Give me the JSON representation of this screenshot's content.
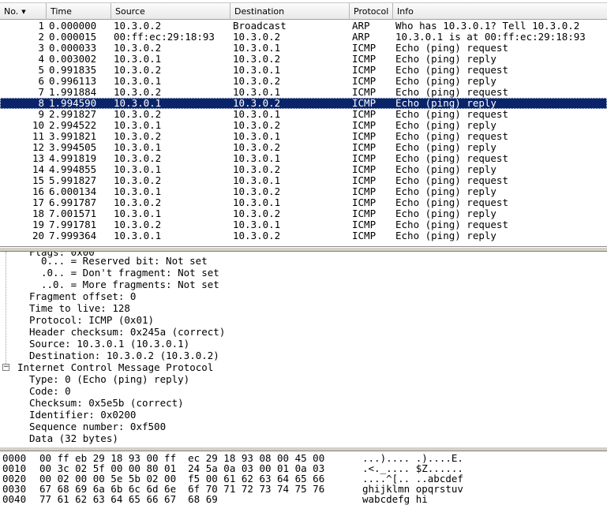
{
  "columns": {
    "no": "No.",
    "time": "Time",
    "source": "Source",
    "destination": "Destination",
    "protocol": "Protocol",
    "info": "Info"
  },
  "packets": [
    {
      "no": "1",
      "time": "0.000000",
      "source": "10.3.0.2",
      "destination": "Broadcast",
      "protocol": "ARP",
      "info": "Who has 10.3.0.1?  Tell 10.3.0.2"
    },
    {
      "no": "2",
      "time": "0.000015",
      "source": "00:ff:ec:29:18:93",
      "destination": "10.3.0.2",
      "protocol": "ARP",
      "info": "10.3.0.1 is at 00:ff:ec:29:18:93"
    },
    {
      "no": "3",
      "time": "0.000033",
      "source": "10.3.0.2",
      "destination": "10.3.0.1",
      "protocol": "ICMP",
      "info": "Echo (ping) request"
    },
    {
      "no": "4",
      "time": "0.003002",
      "source": "10.3.0.1",
      "destination": "10.3.0.2",
      "protocol": "ICMP",
      "info": "Echo (ping) reply"
    },
    {
      "no": "5",
      "time": "0.991835",
      "source": "10.3.0.2",
      "destination": "10.3.0.1",
      "protocol": "ICMP",
      "info": "Echo (ping) request"
    },
    {
      "no": "6",
      "time": "0.996113",
      "source": "10.3.0.1",
      "destination": "10.3.0.2",
      "protocol": "ICMP",
      "info": "Echo (ping) reply"
    },
    {
      "no": "7",
      "time": "1.991884",
      "source": "10.3.0.2",
      "destination": "10.3.0.1",
      "protocol": "ICMP",
      "info": "Echo (ping) request"
    },
    {
      "no": "8",
      "time": "1.994590",
      "source": "10.3.0.1",
      "destination": "10.3.0.2",
      "protocol": "ICMP",
      "info": "Echo (ping) reply",
      "selected": true
    },
    {
      "no": "9",
      "time": "2.991827",
      "source": "10.3.0.2",
      "destination": "10.3.0.1",
      "protocol": "ICMP",
      "info": "Echo (ping) request"
    },
    {
      "no": "10",
      "time": "2.994522",
      "source": "10.3.0.1",
      "destination": "10.3.0.2",
      "protocol": "ICMP",
      "info": "Echo (ping) reply"
    },
    {
      "no": "11",
      "time": "3.991821",
      "source": "10.3.0.2",
      "destination": "10.3.0.1",
      "protocol": "ICMP",
      "info": "Echo (ping) request"
    },
    {
      "no": "12",
      "time": "3.994505",
      "source": "10.3.0.1",
      "destination": "10.3.0.2",
      "protocol": "ICMP",
      "info": "Echo (ping) reply"
    },
    {
      "no": "13",
      "time": "4.991819",
      "source": "10.3.0.2",
      "destination": "10.3.0.1",
      "protocol": "ICMP",
      "info": "Echo (ping) request"
    },
    {
      "no": "14",
      "time": "4.994855",
      "source": "10.3.0.1",
      "destination": "10.3.0.2",
      "protocol": "ICMP",
      "info": "Echo (ping) reply"
    },
    {
      "no": "15",
      "time": "5.991827",
      "source": "10.3.0.2",
      "destination": "10.3.0.1",
      "protocol": "ICMP",
      "info": "Echo (ping) request"
    },
    {
      "no": "16",
      "time": "6.000134",
      "source": "10.3.0.1",
      "destination": "10.3.0.2",
      "protocol": "ICMP",
      "info": "Echo (ping) reply"
    },
    {
      "no": "17",
      "time": "6.991787",
      "source": "10.3.0.2",
      "destination": "10.3.0.1",
      "protocol": "ICMP",
      "info": "Echo (ping) request"
    },
    {
      "no": "18",
      "time": "7.001571",
      "source": "10.3.0.1",
      "destination": "10.3.0.2",
      "protocol": "ICMP",
      "info": "Echo (ping) reply"
    },
    {
      "no": "19",
      "time": "7.991781",
      "source": "10.3.0.2",
      "destination": "10.3.0.1",
      "protocol": "ICMP",
      "info": "Echo (ping) request"
    },
    {
      "no": "20",
      "time": "7.999364",
      "source": "10.3.0.1",
      "destination": "10.3.0.2",
      "protocol": "ICMP",
      "info": "Echo (ping) reply"
    }
  ],
  "details": {
    "ip_fields": [
      "0... = Reserved bit: Not set",
      ".0.. = Don't fragment: Not set",
      "..0. = More fragments: Not set"
    ],
    "ip_more": [
      "Fragment offset: 0",
      "Time to live: 128",
      "Protocol: ICMP (0x01)",
      "Header checksum: 0x245a (correct)",
      "Source: 10.3.0.1 (10.3.0.1)",
      "Destination: 10.3.0.2 (10.3.0.2)"
    ],
    "icmp_title": "Internet Control Message Protocol",
    "icmp_toggle": "−",
    "icmp_fields": [
      "Type: 0 (Echo (ping) reply)",
      "Code: 0",
      "Checksum: 0x5e5b (correct)",
      "Identifier: 0x0200",
      "Sequence number: 0xf500",
      "Data (32 bytes)"
    ]
  },
  "bytes": [
    {
      "offset": "0000",
      "hex": "00 ff eb 29 18 93 00 ff  ec 29 18 93 08 00 45 00",
      "ascii": "...).... .)....E."
    },
    {
      "offset": "0010",
      "hex": "00 3c 02 5f 00 00 80 01  24 5a 0a 03 00 01 0a 03",
      "ascii": ".<._.... $Z......"
    },
    {
      "offset": "0020",
      "hex": "00 02 00 00 5e 5b 02 00  f5 00 61 62 63 64 65 66",
      "ascii": "....^[.. ..abcdef"
    },
    {
      "offset": "0030",
      "hex": "67 68 69 6a 6b 6c 6d 6e  6f 70 71 72 73 74 75 76",
      "ascii": "ghijklmn opqrstuv"
    },
    {
      "offset": "0040",
      "hex": "77 61 62 63 64 65 66 67  68 69",
      "ascii": "wabcdefg hi"
    }
  ],
  "colors": {
    "selection": "#0a246a",
    "selection_text": "#ffffff"
  }
}
